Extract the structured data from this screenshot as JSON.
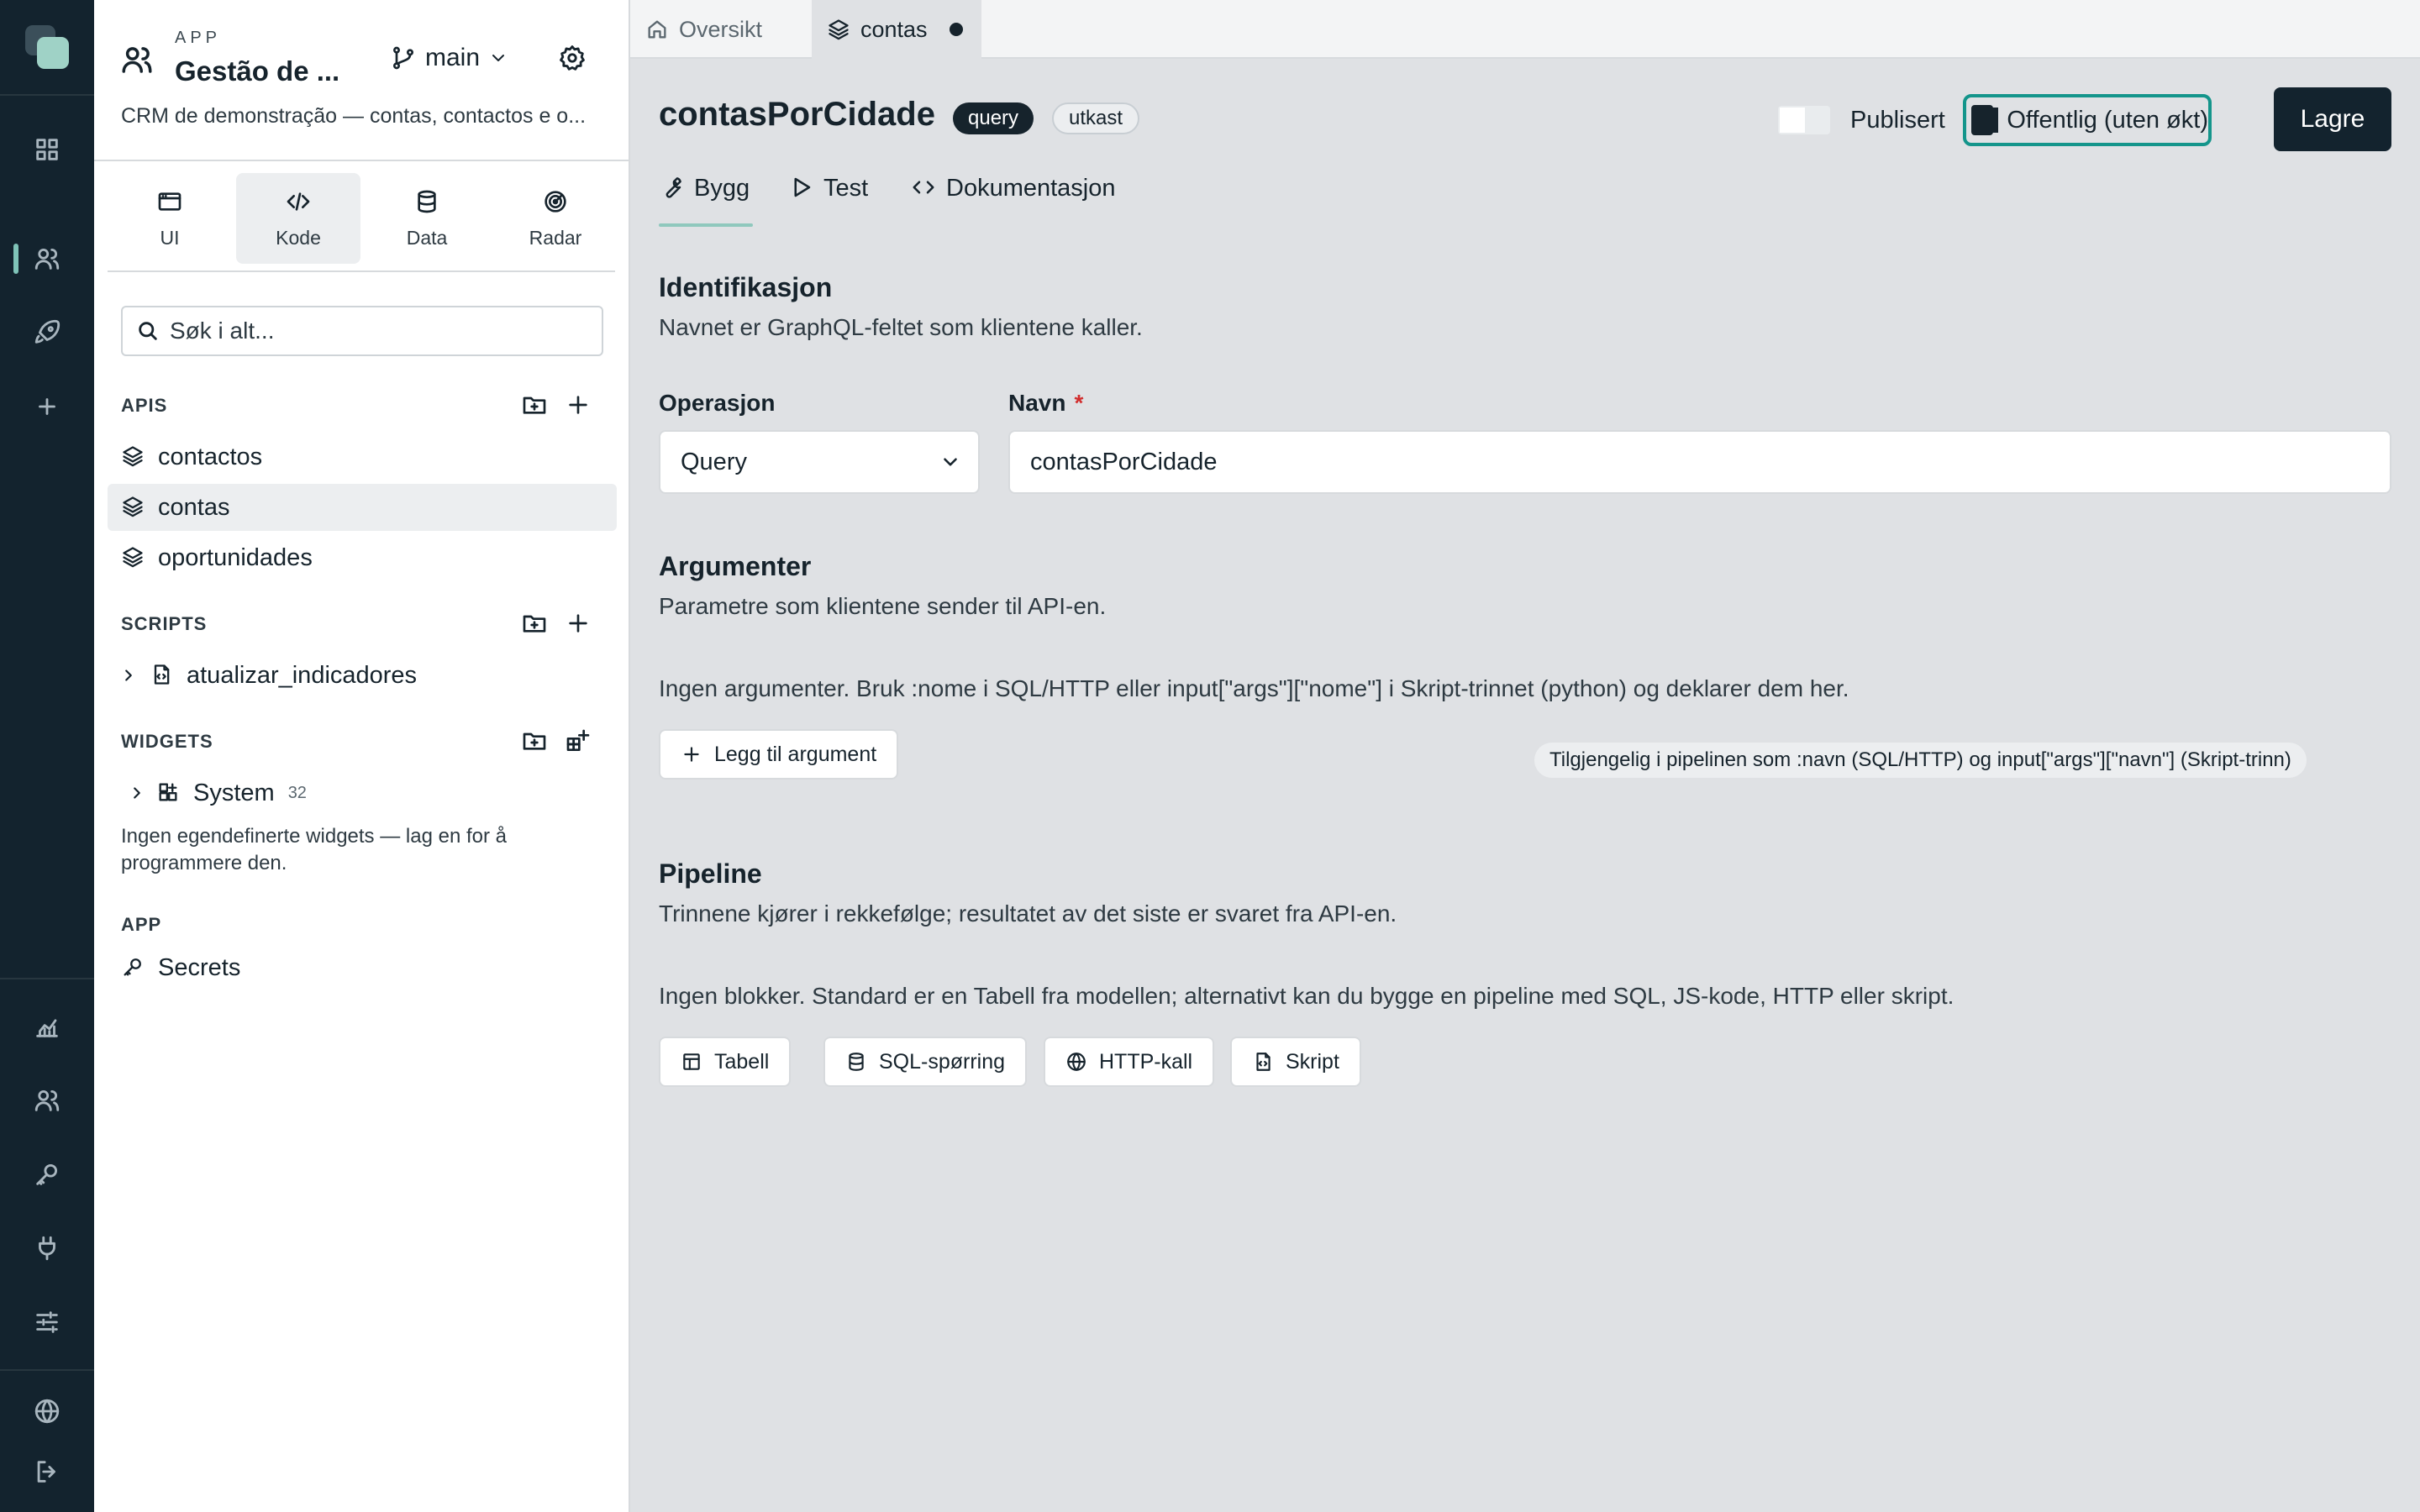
{
  "rail": {
    "items": [
      {
        "name": "dashboard-icon"
      },
      {
        "name": "users-icon",
        "active": true
      },
      {
        "name": "rocket-icon"
      },
      {
        "name": "plus-icon"
      },
      {
        "name": "analytics-icon"
      },
      {
        "name": "team-icon"
      },
      {
        "name": "key-icon"
      },
      {
        "name": "plug-icon"
      },
      {
        "name": "sliders-icon"
      },
      {
        "name": "globe-icon"
      },
      {
        "name": "logout-icon"
      }
    ]
  },
  "app": {
    "kicker": "APP",
    "name": "Gestão de ...",
    "branch": "main",
    "description": "CRM de demonstração — contas, contactos e o..."
  },
  "modes": [
    {
      "label": "UI",
      "icon": "window-icon"
    },
    {
      "label": "Kode",
      "icon": "code-icon",
      "active": true
    },
    {
      "label": "Data",
      "icon": "database-icon"
    },
    {
      "label": "Radar",
      "icon": "radar-icon"
    }
  ],
  "search": {
    "placeholder": "Søk i alt..."
  },
  "sections": {
    "apis": {
      "title": "APIS",
      "items": [
        "contactos",
        "contas",
        "oportunidades"
      ],
      "active": "contas"
    },
    "scripts": {
      "title": "SCRIPTS",
      "items": [
        "atualizar_indicadores"
      ]
    },
    "widgets": {
      "title": "WIDGETS",
      "group": "System",
      "group_count": "32",
      "empty_note": "Ingen egendefinerte widgets — lag en for å programmere den."
    },
    "app": {
      "title": "APP",
      "items": [
        "Secrets"
      ]
    }
  },
  "tabs": [
    {
      "label": "Oversikt",
      "icon": "home-icon"
    },
    {
      "label": "contas",
      "icon": "layers-icon",
      "active": true,
      "unsaved": true
    }
  ],
  "header": {
    "title": "contasPorCidade",
    "badge_type": "query",
    "badge_status": "utkast",
    "published_label": "Publisert",
    "published": false,
    "public_label": "Offentlig (uten økt)",
    "public": true,
    "save_label": "Lagre"
  },
  "subtabs": [
    {
      "label": "Bygg",
      "icon": "wrench-icon",
      "active": true
    },
    {
      "label": "Test",
      "icon": "play-icon"
    },
    {
      "label": "Dokumentasjon",
      "icon": "code-icon"
    }
  ],
  "identification": {
    "title": "Identifikasjon",
    "description": "Navnet er GraphQL-feltet som klientene kaller.",
    "operation_label": "Operasjon",
    "operation_value": "Query",
    "name_label": "Navn",
    "name_required": "*",
    "name_value": "contasPorCidade"
  },
  "arguments": {
    "title": "Argumenter",
    "description": "Parametre som klientene sender til API-en.",
    "empty": "Ingen argumenter. Bruk :nome i SQL/HTTP eller input[\"args\"][\"nome\"] i Skript-trinnet (python) og deklarer dem her.",
    "add_label": "Legg til argument",
    "hint": "Tilgjengelig i pipelinen som :navn (SQL/HTTP) og input[\"args\"][\"navn\"] (Skript-trinn)"
  },
  "pipeline": {
    "title": "Pipeline",
    "description": "Trinnene kjører i rekkefølge; resultatet av det siste er svaret fra API-en.",
    "empty": "Ingen blokker. Standard er en Tabell fra modellen; alternativt kan du bygge en pipeline med SQL, JS-kode, HTTP eller skript.",
    "blocks": [
      {
        "label": "Tabell",
        "icon": "table-icon"
      },
      {
        "label": "SQL-spørring",
        "icon": "database-icon"
      },
      {
        "label": "HTTP-kall",
        "icon": "globe-icon"
      },
      {
        "label": "Skript",
        "icon": "script-icon"
      }
    ]
  },
  "colors": {
    "rail_bg": "#13232e",
    "accent_teal": "#14958b",
    "active_indicator": "#7fc3b8",
    "primary_button": "#13232e",
    "required": "#d12d2d"
  }
}
